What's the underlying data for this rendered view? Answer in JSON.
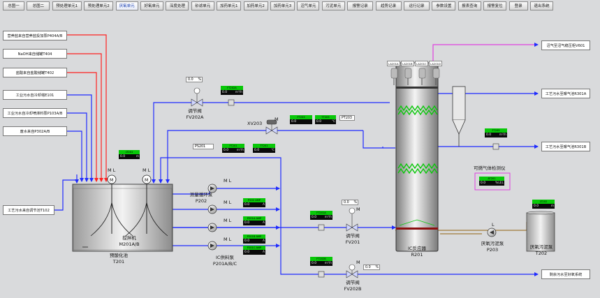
{
  "nav": [
    {
      "label": "总图一",
      "active": false
    },
    {
      "label": "总图二",
      "active": false
    },
    {
      "label": "预处理单元1",
      "active": false
    },
    {
      "label": "预处理单元2",
      "active": false
    },
    {
      "label": "厌氧单元",
      "active": true
    },
    {
      "label": "好氧单元",
      "active": false
    },
    {
      "label": "深度处理",
      "active": false
    },
    {
      "label": "砂滤单元",
      "active": false
    },
    {
      "label": "加药单元1",
      "active": false
    },
    {
      "label": "加药单元2",
      "active": false
    },
    {
      "label": "加药单元3",
      "active": false
    },
    {
      "label": "沼气单元",
      "active": false
    },
    {
      "label": "污泥单元",
      "active": false
    },
    {
      "label": "报警记录",
      "active": false
    },
    {
      "label": "趋势记录",
      "active": false
    },
    {
      "label": "运行记录",
      "active": false
    },
    {
      "label": "参数设置",
      "active": false
    },
    {
      "label": "报表查询",
      "active": false
    },
    {
      "label": "报警复位",
      "active": false
    },
    {
      "label": "登录",
      "active": false
    },
    {
      "label": "退出系统",
      "active": false
    }
  ],
  "sources": [
    "营养盐来自营养盐投加泵P404A/B",
    "NaOH来自储罐T404",
    "盐酸来自盐酸储罐T402",
    "工业污水自冷却塔E101",
    "工业污水自冷却喷淋料泵P103A/B",
    "废水来自P302A/B"
  ],
  "source_bottom": "工艺污水来自调节池T102",
  "destinations": [
    "沼气至沼气稳压柜V601",
    "工艺污水至曝气池R301A",
    "工艺污水至曝气池R301B",
    "剩余污水至好氧系统"
  ],
  "tank": {
    "name1": "预酸化池",
    "name2": "T201",
    "mixer1": "搅拌机",
    "mixer2": "M201A/B",
    "ml": "M L"
  },
  "fv202a": {
    "name1": "调节阀",
    "name2": "FV202A",
    "pct": "0.0",
    "unit": "%",
    "tag": "FT202A",
    "value": "0.0",
    "vunit": "m³/h"
  },
  "xv203": {
    "name": "XV203",
    "m": "M",
    "tag1": "FT203",
    "val1": "0.0",
    "tag2": "TT203",
    "val2": "0.0",
    "unit2": "℃",
    "tag3": "PT203"
  },
  "ps201": {
    "tag": "PS201",
    "tag2": "FT201",
    "val2": "0.0",
    "vunit2": "m³/h",
    "tag3": "TT201",
    "val3": "0.0",
    "unit3": "℃"
  },
  "tank_meter": {
    "tag": "LT201",
    "value": "0.0",
    "unit": "m"
  },
  "p202": {
    "name1": "测量循环泵",
    "name2": "P202",
    "ml": "M L",
    "tag": "P202 AMP",
    "value": "0.0",
    "unit": "A"
  },
  "p201": {
    "name1": "IC供料泵",
    "name2": "P201A/B/C",
    "ml": "M L",
    "pumps": [
      {
        "tag": "P201A AMP",
        "value": "0.0",
        "unit": "A"
      },
      {
        "tag": "P201B AMP",
        "value": "0.0",
        "unit": "A"
      },
      {
        "tag": "P201C AMP",
        "value": "0.0",
        "unit": "A"
      }
    ]
  },
  "fv201": {
    "name1": "调节阀",
    "name2": "FV201",
    "pct": "0.0",
    "unit": "%",
    "tag": "FT201A",
    "value": "0.0",
    "vunit": "m³/h",
    "m": "M"
  },
  "fv202b": {
    "name1": "调节阀",
    "name2": "FV202B",
    "pct": "0.0",
    "unit": "%",
    "tag": "FT202B",
    "value": "0.0",
    "vunit": "m³/h",
    "m": "M"
  },
  "reactor": {
    "name1": "IC反应器",
    "name2": "R201",
    "levels": [
      "LA201A",
      "LA201B",
      "LA201C",
      "LA201D"
    ]
  },
  "ft205": {
    "tag": "FT205",
    "value": "0.0",
    "unit": "m³/h"
  },
  "gas": {
    "title": "可燃气体检测仪",
    "tag": "AT201",
    "value": "0.0",
    "unit": "%LEL"
  },
  "p203": {
    "name1": "厌氧污泥泵",
    "name2": "P203",
    "l": "L"
  },
  "t202": {
    "name1": "厌氧污泥泵",
    "name2": "T202",
    "tag": "LT202",
    "value": "0.0",
    "unit": "m"
  },
  "colors": {
    "blue": "#1f2bff",
    "red": "#ff2020",
    "magenta": "#e040e0",
    "green": "#08c808",
    "brown": "#a07a3a"
  }
}
